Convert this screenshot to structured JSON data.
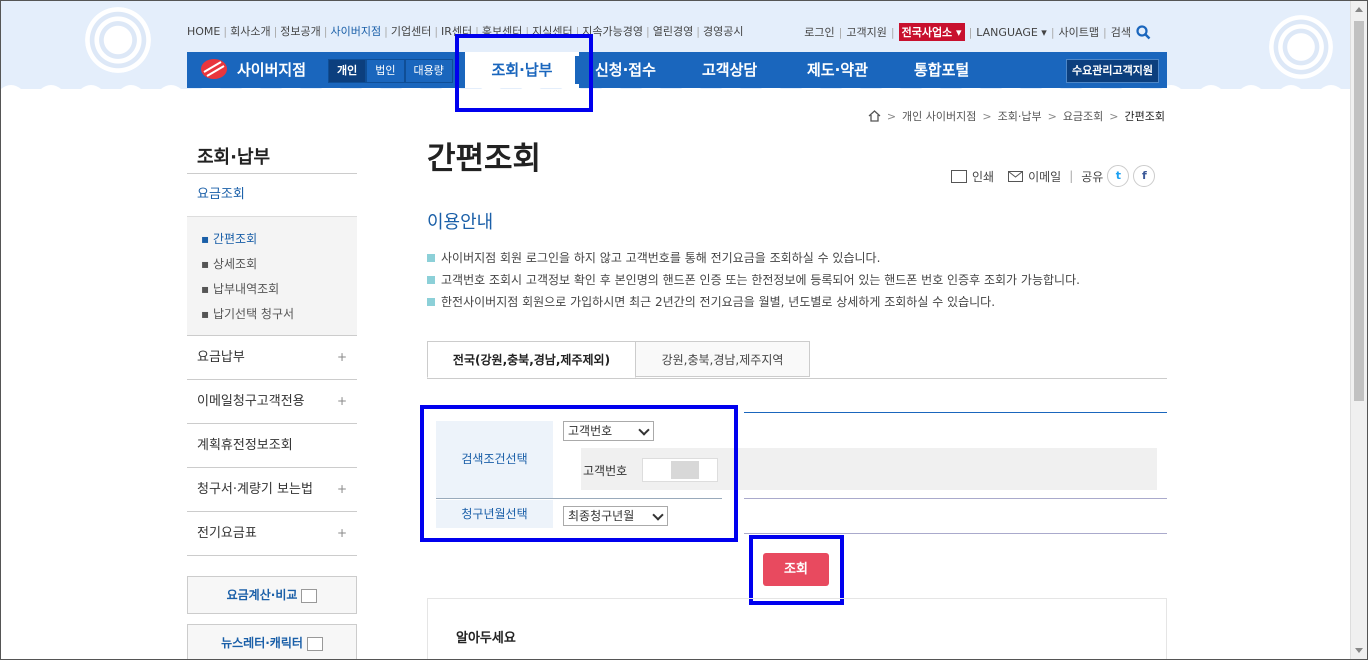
{
  "util_nav": {
    "items": [
      "HOME",
      "회사소개",
      "정보공개",
      "사이버지점",
      "기업센터",
      "IR센터",
      "홍보센터",
      "지식센터",
      "지속가능경영",
      "열린경영",
      "경영공시"
    ],
    "highlight_index": 3
  },
  "right_util": {
    "login": "로그인",
    "support": "고객지원",
    "national_office": "전국사업소",
    "language": "LANGUAGE",
    "sitemap": "사이트맵",
    "search": "검색"
  },
  "gnb": {
    "logo_text": "사이버지점",
    "seg_personal": "개인",
    "seg_corporate": "법인",
    "seg_bulk": "대용량",
    "menu_inquiry": "조회·납부",
    "menu_apply": "신청·접수",
    "menu_counsel": "고객상담",
    "menu_rules": "제도·약관",
    "menu_portal": "통합포털",
    "demand_button": "수요관리고객지원"
  },
  "breadcrumb": {
    "items": [
      "개인 사이버지점",
      "조회·납부",
      "요금조회",
      "간편조회"
    ]
  },
  "lnb": {
    "title": "조회·납부",
    "current": "요금조회",
    "sub": [
      "간편조회",
      "상세조회",
      "납부내역조회",
      "납기선택 청구서"
    ],
    "items": [
      "요금납부",
      "이메일청구고객전용",
      "계획휴전정보조회",
      "청구서·계량기 보는법",
      "전기요금표"
    ],
    "plus": "+",
    "banner1": "요금계산·비교",
    "banner2": "뉴스레터·캐릭터"
  },
  "page": {
    "title": "간편조회",
    "print": "인쇄",
    "email": "이메일",
    "share": "공유",
    "twitter": "t",
    "facebook": "f",
    "section": "이용안내",
    "guide": [
      "사이버지점 회원 로그인을 하지 않고 고객번호를 통해 전기요금을 조회하실 수 있습니다.",
      "고객번호 조회시 고객정보 확인 후 본인명의 핸드폰 인증 또는 한전정보에 등록되어 있는 핸드폰 번호 인증후 조회가 가능합니다.",
      "한전사이버지점 회원으로 가입하시면 최근 2년간의 전기요금을 월별, 년도별로 상세하게 조회하실 수 있습니다."
    ]
  },
  "tabs": {
    "tab1": "전국(강원,충북,경남,제주제외)",
    "tab2": "강원,충북,경남,제주지역"
  },
  "form": {
    "label_condition": "검색조건선택",
    "condition_value": "고객번호",
    "cust_label": "고객번호",
    "label_month": "청구년월선택",
    "month_value": "최종청구년월",
    "submit": "조회"
  },
  "notice": {
    "title": "알아두세요"
  },
  "colors": {
    "brand_blue": "#1a66bd",
    "highlight_box": "#0000ee",
    "submit_red": "#e84a5f"
  }
}
